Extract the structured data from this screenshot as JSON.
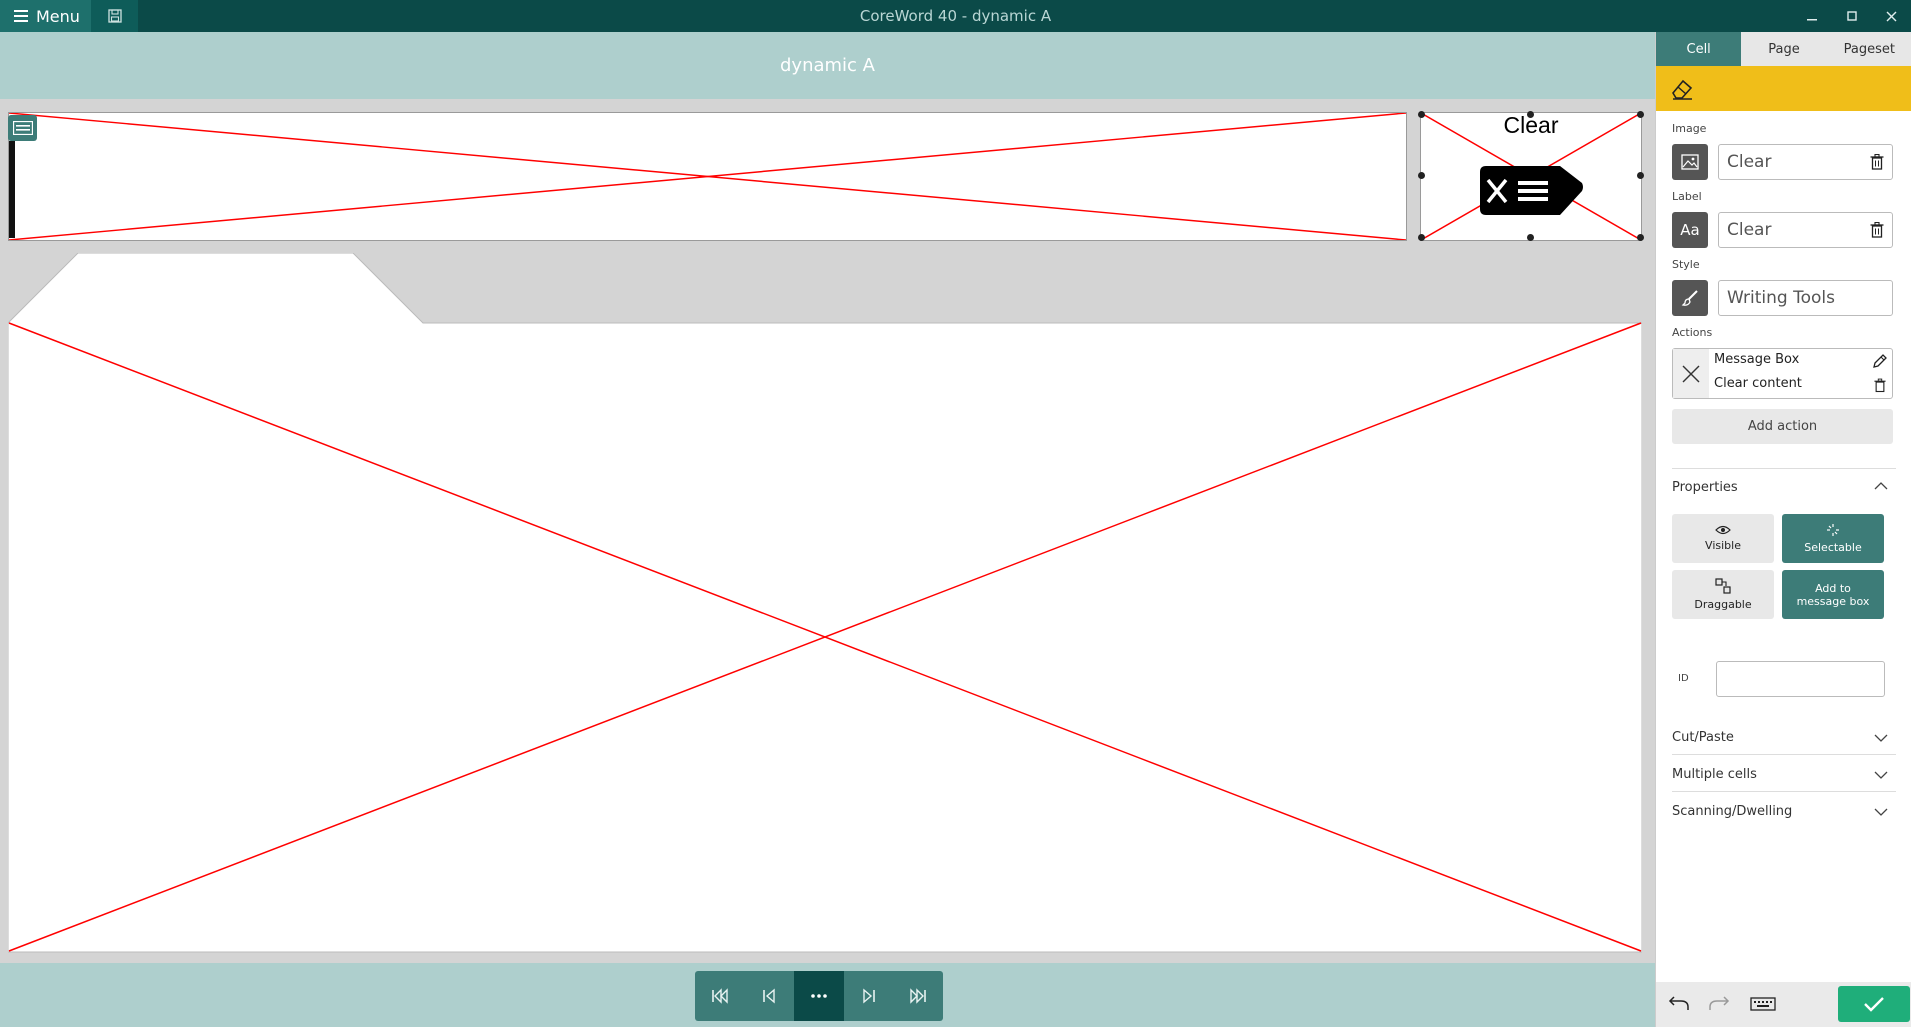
{
  "app": {
    "title": "CoreWord 40 - dynamic A",
    "menu_label": "Menu"
  },
  "page": {
    "name": "dynamic A",
    "clear_cell_label": "Clear"
  },
  "panel": {
    "tabs": [
      "Cell",
      "Page",
      "Pageset"
    ],
    "active_tab": "Cell",
    "image_label": "Image",
    "image_value": "Clear",
    "label_label": "Label",
    "label_value": "Clear",
    "style_label": "Style",
    "style_value": "Writing Tools",
    "actions_label": "Actions",
    "actions": [
      "Message Box",
      "Clear content"
    ],
    "add_action": "Add action",
    "properties_title": "Properties",
    "properties": {
      "visible": "Visible",
      "selectable": "Selectable",
      "draggable": "Draggable",
      "add_to_message_box": "Add to message box"
    },
    "id_label": "ID",
    "id_value": "",
    "sections": [
      "Cut/Paste",
      "Multiple cells",
      "Scanning/Dwelling"
    ]
  },
  "colors": {
    "titlebar": "#0b4a48",
    "teal": "#3d7c78",
    "header": "#aecfcd",
    "accent_yellow": "#f0be19",
    "ok_green": "#1fae7a",
    "cross_red": "#ff0000"
  }
}
